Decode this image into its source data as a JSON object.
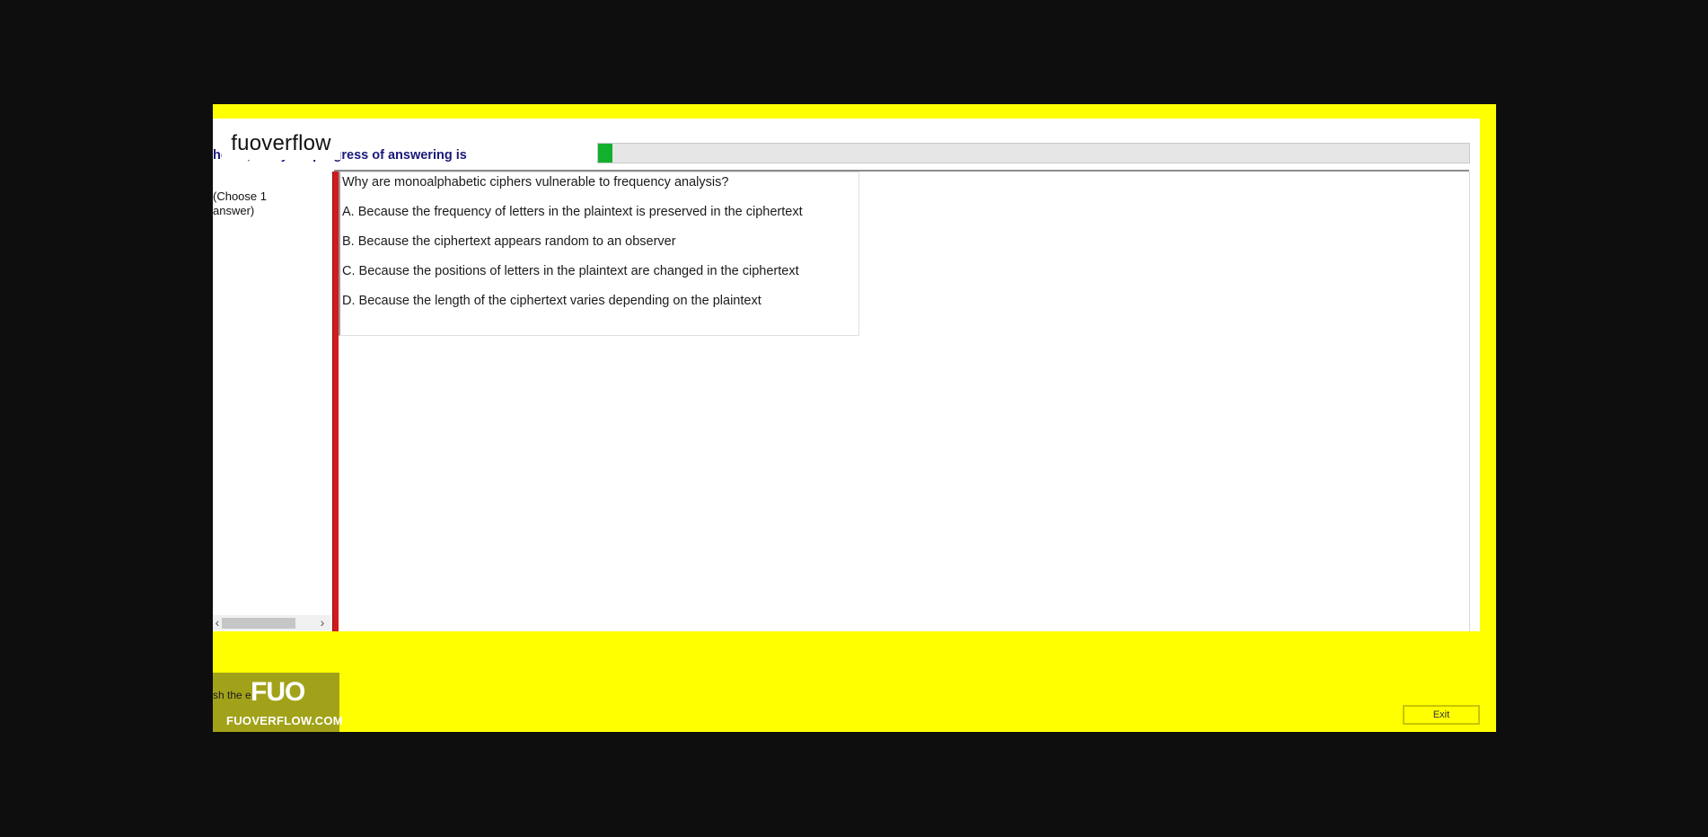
{
  "header": {
    "text": "he            ns, and your progress of answering is",
    "brand_label": "fuoverflow",
    "progress_fraction": 0.017,
    "progress_color": "#12b02d"
  },
  "sidebar": {
    "instruction": "(Choose 1 answer)"
  },
  "question": {
    "text": "Why are monoalphabetic ciphers vulnerable to frequency analysis?",
    "options": [
      "A.  Because the frequency of letters in the plaintext is preserved in the ciphertext",
      "B.  Because the ciphertext appears random to an observer",
      "C.  Because the positions of letters in the plaintext are changed in the ciphertext",
      "D.  Because the length of the ciphertext varies depending on the plaintext"
    ]
  },
  "footer": {
    "partial_text": "sh the e",
    "watermark_mark": "FUO",
    "watermark_site": "FUOVERFLOW.COM",
    "exit_label": "Exit"
  },
  "colors": {
    "background": "#0e0e0e",
    "app_frame": "#ffff00",
    "accent_bar": "#d31b1b",
    "header_text": "#1a1a7a"
  }
}
